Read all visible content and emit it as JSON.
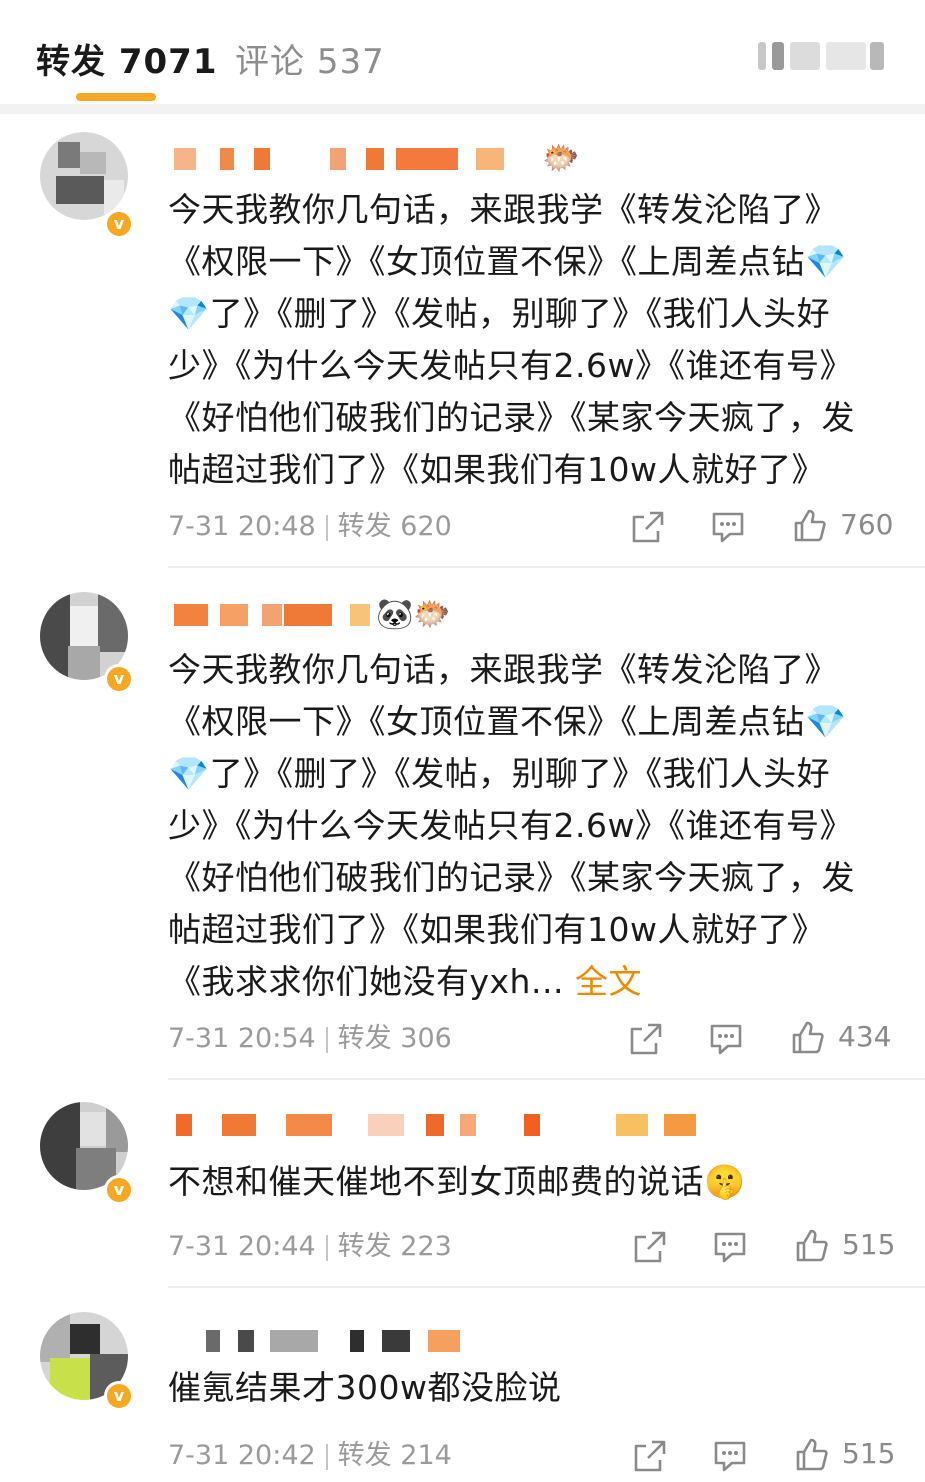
{
  "tabs": {
    "repost_label": "转发",
    "repost_count": "7071",
    "comment_label": "评论",
    "comment_count": "537",
    "active_color": "#f7a823"
  },
  "posts": [
    {
      "name_emojis": "🐡",
      "text": "今天我教你几句话，来跟我学《转发沦陷了》《权限一下》《女顶位置不保》《上周差点钻💎💎了》《删了》《发帖，别聊了》《我们人头好少》《为什么今天发帖只有2.6w》《谁还有号》《好怕他们破我们的记录》《某家今天疯了，发帖超过我们了》《如果我们有10w人就好了》",
      "more": "",
      "time": "7-31 20:48",
      "repost_label": "转发",
      "repost_count": "620",
      "likes": "760"
    },
    {
      "name_emojis": "🐼🐡",
      "text": "今天我教你几句话，来跟我学《转发沦陷了》《权限一下》《女顶位置不保》《上周差点钻💎💎了》《删了》《发帖，别聊了》《我们人头好少》《为什么今天发帖只有2.6w》《谁还有号》《好怕他们破我们的记录》《某家今天疯了，发帖超过我们了》《如果我们有10w人就好了》《我求求你们她没有yxh...",
      "more": "全文",
      "time": "7-31 20:54",
      "repost_label": "转发",
      "repost_count": "306",
      "likes": "434"
    },
    {
      "name_emojis": "",
      "text": "不想和催天催地不到女顶邮费的说话🤫",
      "more": "",
      "time": "7-31 20:44",
      "repost_label": "转发",
      "repost_count": "223",
      "likes": "515"
    },
    {
      "name_emojis": "",
      "text": "催氪结果才300w都没脸说",
      "more": "",
      "time": "7-31 20:42",
      "repost_label": "转发",
      "repost_count": "214",
      "likes": "515"
    }
  ]
}
